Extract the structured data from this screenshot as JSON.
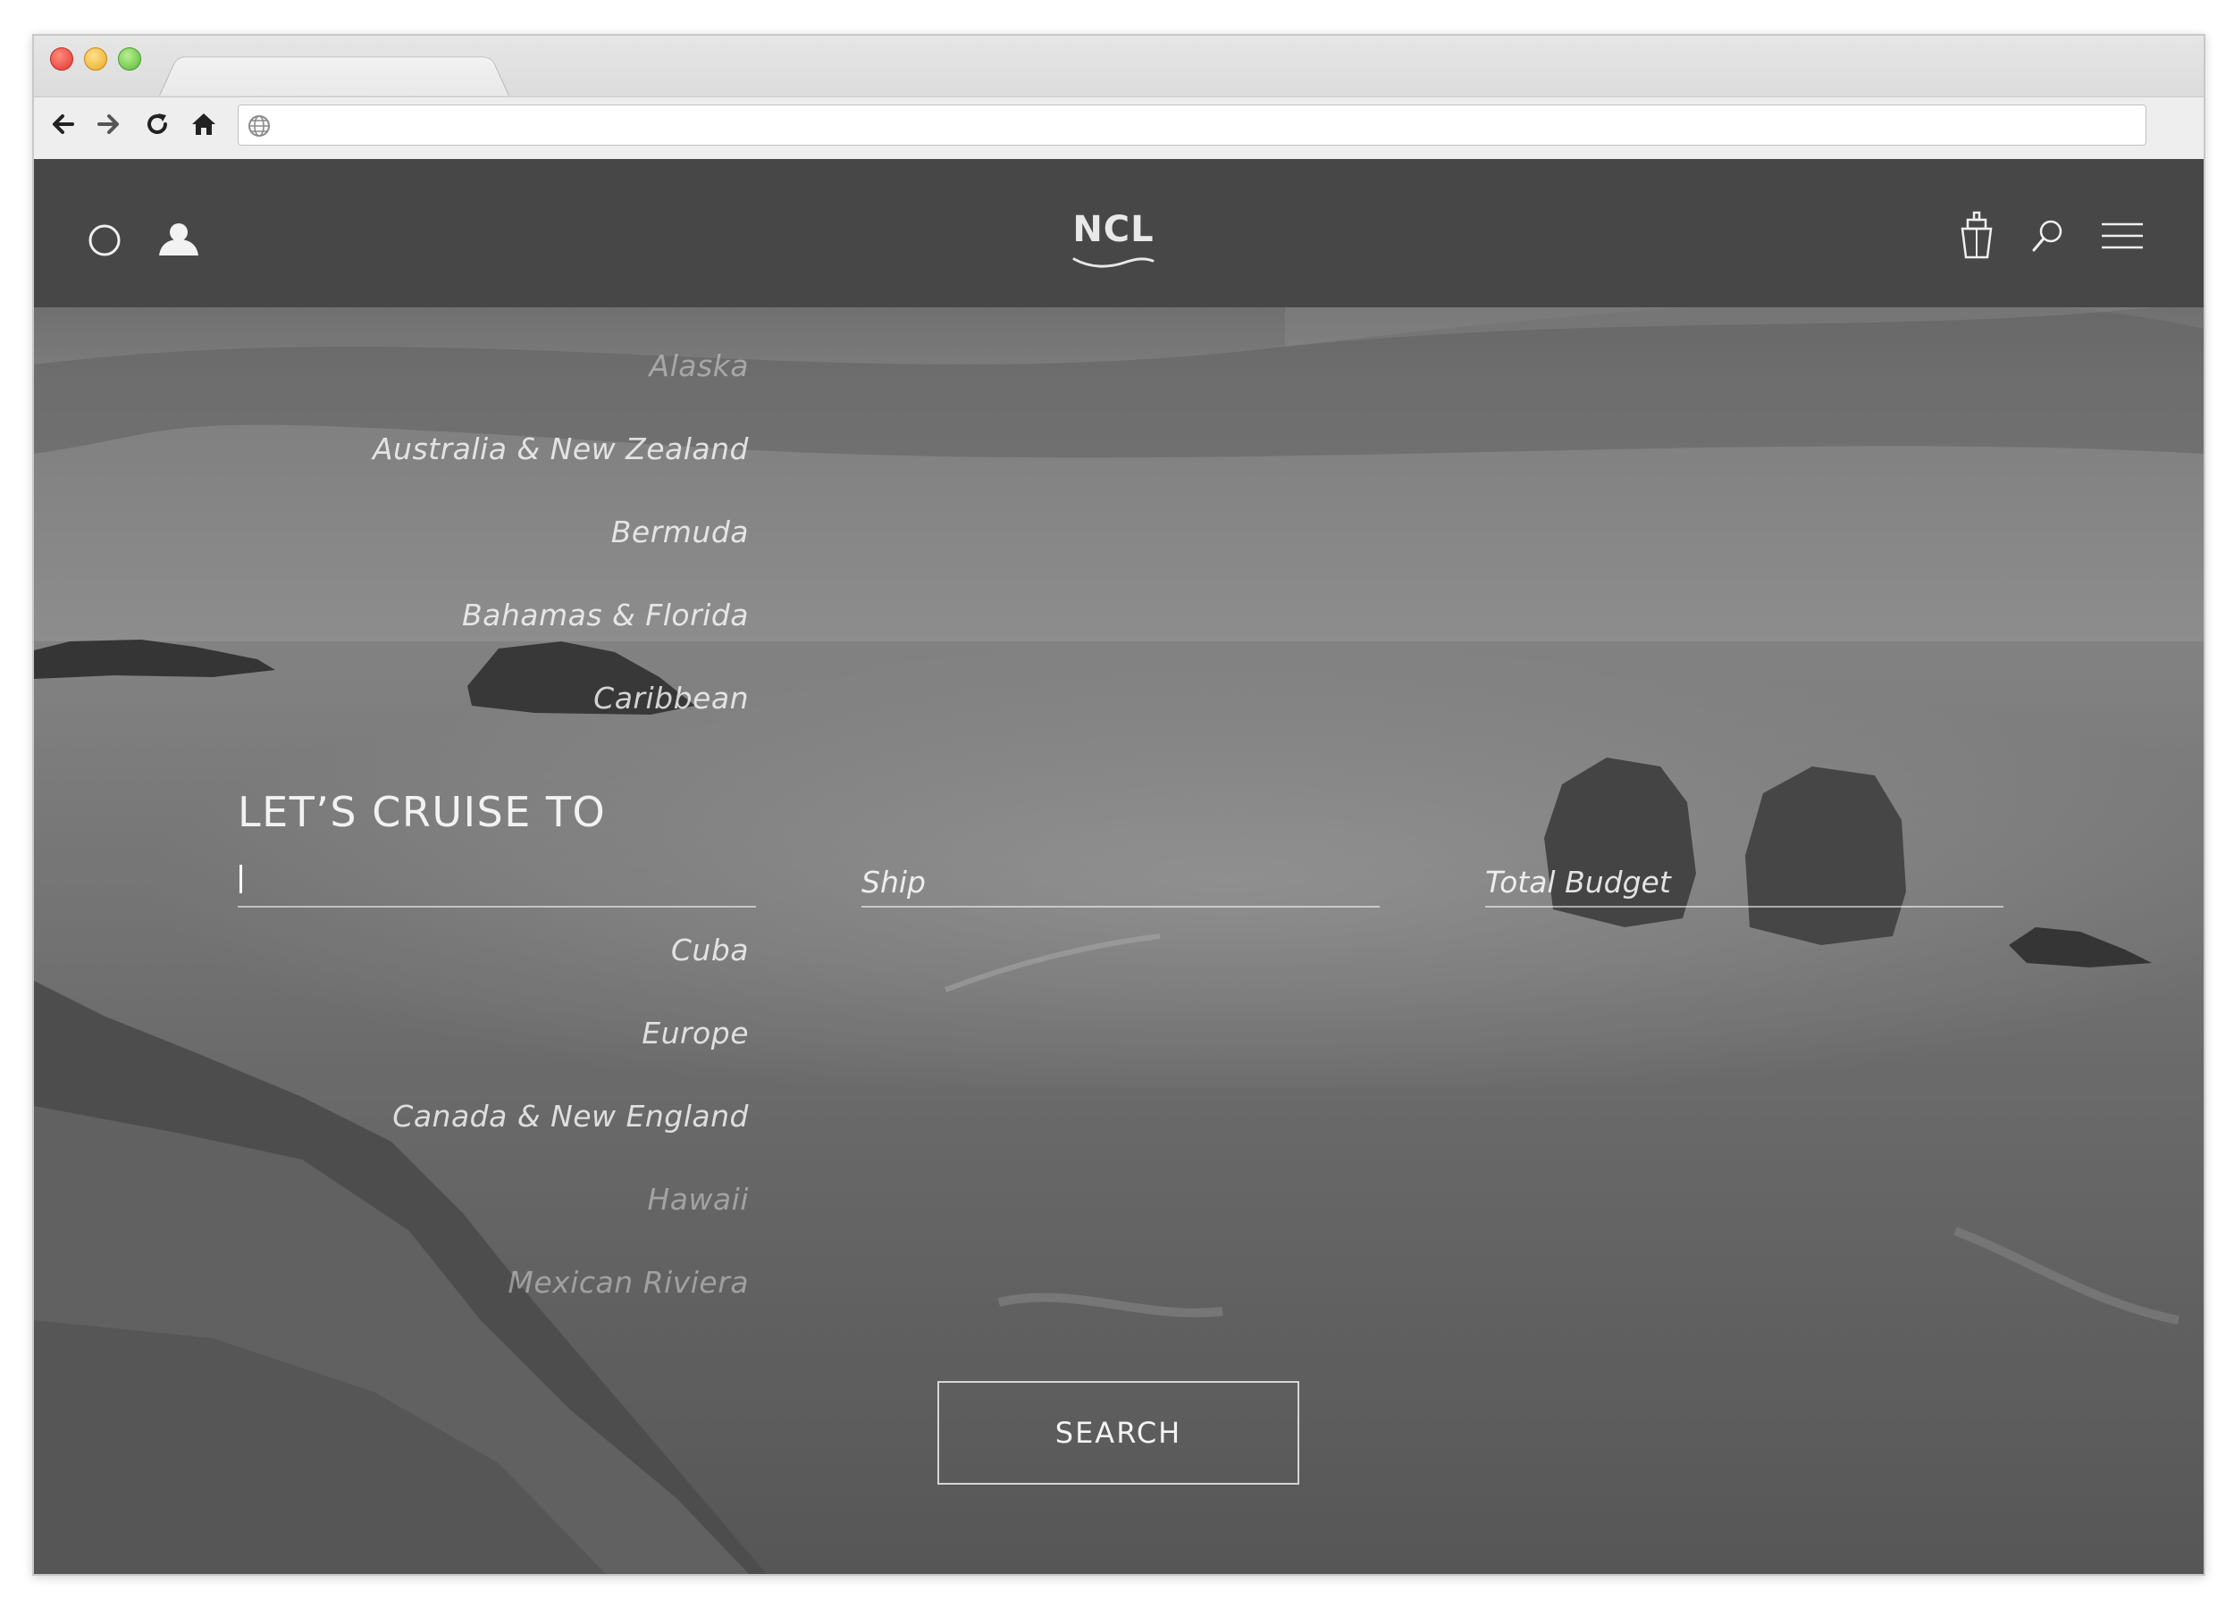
{
  "browser": {
    "url": ""
  },
  "header": {
    "logo_text": "NCL"
  },
  "destinations_above": [
    {
      "label": "Alaska",
      "faded": true
    },
    {
      "label": "Australia & New Zealand",
      "faded": false
    },
    {
      "label": "Bermuda",
      "faded": false
    },
    {
      "label": "Bahamas & Florida",
      "faded": false
    },
    {
      "label": "Caribbean",
      "faded": false
    }
  ],
  "destinations_below": [
    {
      "label": "Cuba",
      "faded": false
    },
    {
      "label": "Europe",
      "faded": false
    },
    {
      "label": "Canada & New England",
      "faded": false
    },
    {
      "label": "Hawaii",
      "faded": true
    },
    {
      "label": "Mexican Riviera",
      "faded": true
    }
  ],
  "search_form": {
    "title": "LET’S CRUISE TO",
    "destination_value": "",
    "ship_placeholder": "Ship",
    "budget_placeholder": "Total Budget",
    "search_label": "SEARCH"
  },
  "colors": {
    "header_bg": "#474747",
    "text": "#ffffff"
  }
}
